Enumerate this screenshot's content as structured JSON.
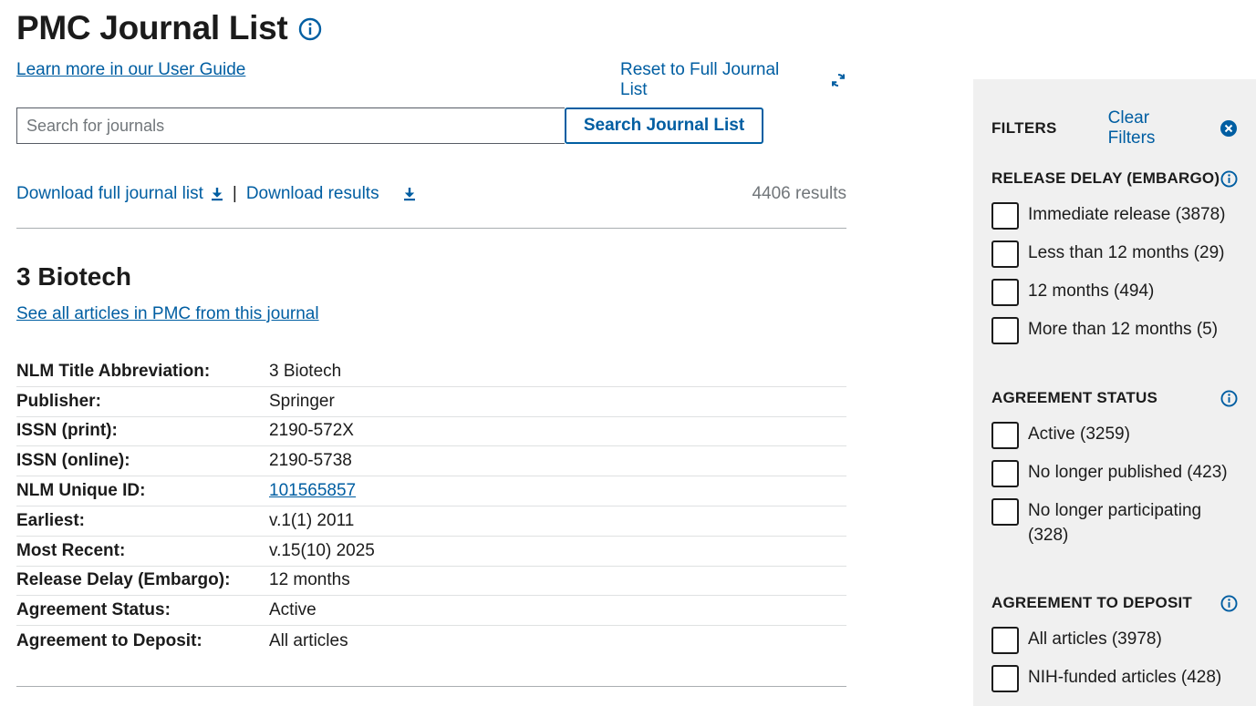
{
  "header": {
    "title": "PMC Journal List",
    "user_guide_link": "Learn more in our User Guide",
    "reset_link": "Reset to Full Journal List"
  },
  "search": {
    "placeholder": "Search for journals",
    "value": "",
    "button_label": "Search Journal List"
  },
  "downloads": {
    "full_list_label": "Download full journal list",
    "separator": "|",
    "results_label": "Download results",
    "results_count": "4406 results"
  },
  "journal": {
    "name": "3 Biotech",
    "articles_link": "See all articles in PMC from this journal",
    "details": [
      {
        "label": "NLM Title Abbreviation:",
        "value": "3 Biotech"
      },
      {
        "label": "Publisher:",
        "value": "Springer"
      },
      {
        "label": "ISSN (print):",
        "value": "2190-572X"
      },
      {
        "label": "ISSN (online):",
        "value": "2190-5738"
      },
      {
        "label": "NLM Unique ID:",
        "value": "101565857"
      },
      {
        "label": "Earliest:",
        "value": "v.1(1) 2011"
      },
      {
        "label": "Most Recent:",
        "value": "v.15(10) 2025"
      },
      {
        "label": "Release Delay (Embargo):",
        "value": "12 months"
      },
      {
        "label": "Agreement Status:",
        "value": "Active"
      },
      {
        "label": "Agreement to Deposit:",
        "value": "All articles"
      }
    ]
  },
  "filters": {
    "heading": "FILTERS",
    "clear_label": "Clear Filters",
    "sections": [
      {
        "title": "RELEASE DELAY (EMBARGO)",
        "options": [
          "Immediate release (3878)",
          "Less than 12 months (29)",
          "12 months (494)",
          "More than 12 months (5)"
        ]
      },
      {
        "title": "AGREEMENT STATUS",
        "options": [
          "Active (3259)",
          "No longer published (423)",
          "No longer participating (328)"
        ]
      },
      {
        "title": "AGREEMENT TO DEPOSIT",
        "options": [
          "All articles (3978)",
          "NIH-funded articles (428)"
        ]
      }
    ]
  },
  "colors": {
    "link": "#005ea2",
    "text": "#1b1b1b",
    "muted": "#71767a",
    "sidebar_bg": "#f0f0f0"
  },
  "icons": [
    "info-icon",
    "refresh-icon",
    "download-icon",
    "close-circle-icon"
  ]
}
